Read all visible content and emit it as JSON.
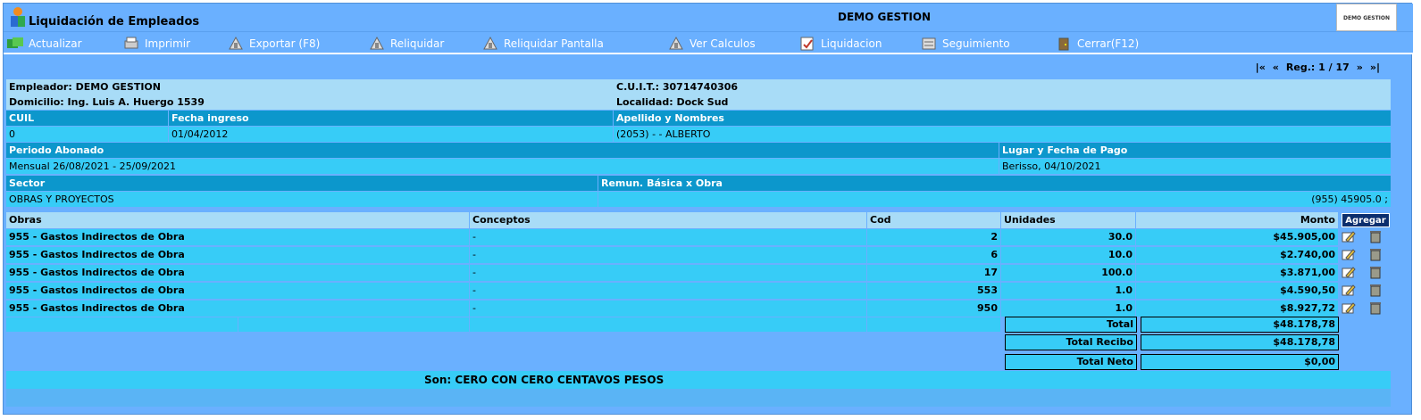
{
  "window": {
    "app_title": "Liquidación de Empleados",
    "company": "DEMO GESTION",
    "brand_label": "DEMO GESTION"
  },
  "toolbar": {
    "actualizar": "Actualizar",
    "imprimir": "Imprimir",
    "exportar": "Exportar (F8)",
    "reliquidar": "Reliquidar",
    "reliquidar_pantalla": "Reliquidar Pantalla",
    "ver_calculos": "Ver Calculos",
    "liquidacion": "Liquidacion",
    "seguimiento": "Seguimiento",
    "cerrar": "Cerrar(F12)"
  },
  "pager": {
    "first": "|«",
    "prev": "«",
    "reg": "Reg.: 1 / 17",
    "next": "»",
    "last": "»|"
  },
  "employer": {
    "empleador": "Empleador: DEMO GESTION",
    "cuit": "C.U.I.T.: 30714740306",
    "domicilio": "Domicilio: Ing. Luis A. Huergo 1539",
    "localidad": "Localidad: Dock Sud"
  },
  "employee": {
    "h_cuil": "CUIL",
    "h_fecha": "Fecha ingreso",
    "h_apellido": "Apellido y Nombres",
    "cuil": "0",
    "fecha": "01/04/2012",
    "apellido": "(2053) - - ALBERTO",
    "h_periodo": "Periodo Abonado",
    "h_lugar": "Lugar y Fecha de Pago",
    "periodo": "Mensual 26/08/2021 - 25/09/2021",
    "lugar": "Berisso, 04/10/2021",
    "h_sector": "Sector",
    "h_remun": "Remun. Básica x Obra",
    "sector": "OBRAS Y PROYECTOS",
    "remun": "(955) 45905.0 ;"
  },
  "grid": {
    "headers": {
      "obras": "Obras",
      "conceptos": "Conceptos",
      "cod": "Cod",
      "unidades": "Unidades",
      "monto": "Monto"
    },
    "add_button": "Agregar",
    "rows": [
      {
        "obra": "955 - Gastos Indirectos de Obra",
        "concepto": "-",
        "cod": "2",
        "unidades": "30.0",
        "monto": "$45.905,00"
      },
      {
        "obra": "955 - Gastos Indirectos de Obra",
        "concepto": "-",
        "cod": "6",
        "unidades": "10.0",
        "monto": "$2.740,00"
      },
      {
        "obra": "955 - Gastos Indirectos de Obra",
        "concepto": "-",
        "cod": "17",
        "unidades": "100.0",
        "monto": "$3.871,00"
      },
      {
        "obra": "955 - Gastos Indirectos de Obra",
        "concepto": "-",
        "cod": "553",
        "unidades": "1.0",
        "monto": "$4.590,50"
      },
      {
        "obra": "955 - Gastos Indirectos de Obra",
        "concepto": "-",
        "cod": "950",
        "unidades": "1.0",
        "monto": "$8.927,72"
      }
    ]
  },
  "totals": {
    "total_label": "Total",
    "total": "$48.178,78",
    "recibo_label": "Total Recibo",
    "recibo": "$48.178,78",
    "neto_label": "Total Neto",
    "neto": "$0,00"
  },
  "son": "Son:  CERO CON CERO CENTAVOS   PESOS",
  "icons": {
    "actualizar": "refresh-icon",
    "imprimir": "printer-icon",
    "exportar": "export-icon",
    "reliquidar": "recalc-icon",
    "ver_calculos": "calculations-icon",
    "liquidacion": "payroll-icon",
    "seguimiento": "tracking-icon",
    "cerrar": "close-icon",
    "edit": "edit-icon",
    "delete": "trash-icon"
  }
}
